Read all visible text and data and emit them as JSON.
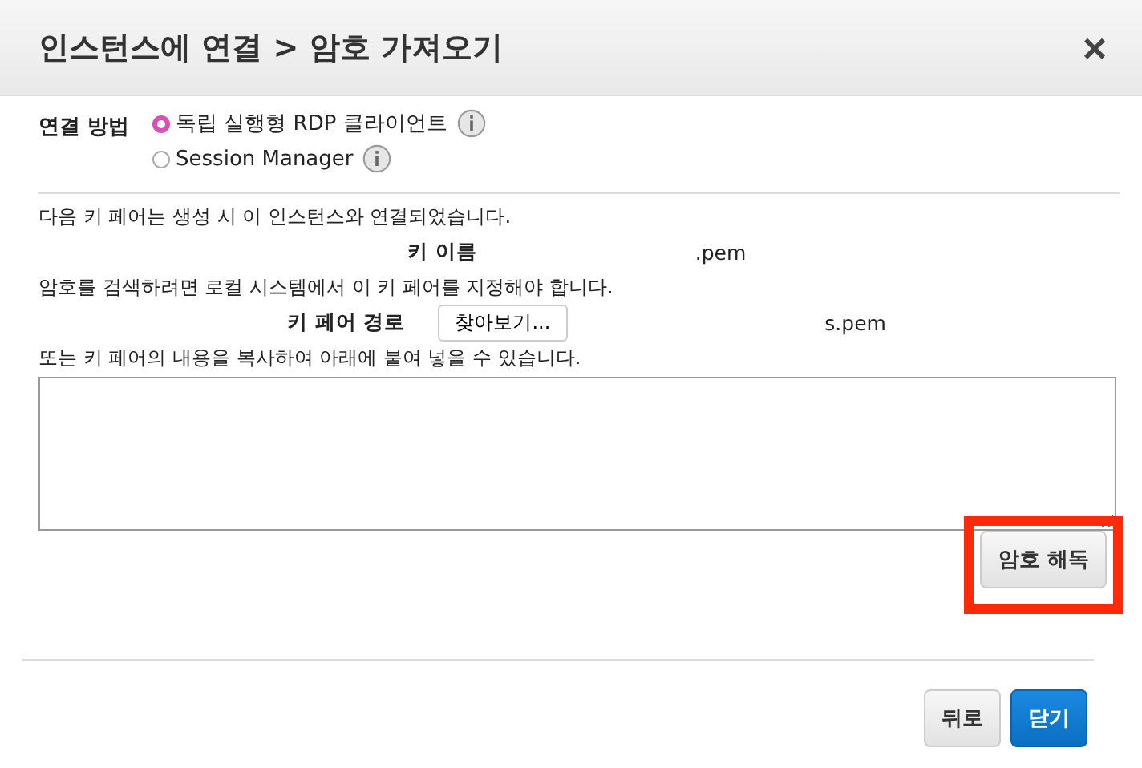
{
  "dialog": {
    "title": "인스턴스에 연결 > 암호 가져오기",
    "close": "×"
  },
  "connection_method": {
    "label": "연결 방법",
    "options": [
      {
        "label": "독립 실행형 RDP 클라이언트",
        "selected": true
      },
      {
        "label": "Session Manager",
        "selected": false
      }
    ]
  },
  "key_pair_note": "다음 키 페어는 생성 시 이 인스턴스와 연결되었습니다.",
  "key_name": {
    "label": "키 이름",
    "value": ".pem"
  },
  "retrieve_note": "암호를 검색하려면 로컬 시스템에서 이 키 페어를 지정해야 합니다.",
  "key_path": {
    "label": "키 페어 경로",
    "browse_button": "찾아보기...",
    "file": "s.pem"
  },
  "paste_note": "또는 키 페어의 내용을 복사하여 아래에 붙여 넣을 수 있습니다.",
  "decrypt_button": {
    "label": "암호 해독",
    "highlighted": true
  },
  "footer_buttons": [
    {
      "label": "뒤로",
      "kind": "secondary"
    },
    {
      "label": "닫기",
      "kind": "primary"
    }
  ]
}
